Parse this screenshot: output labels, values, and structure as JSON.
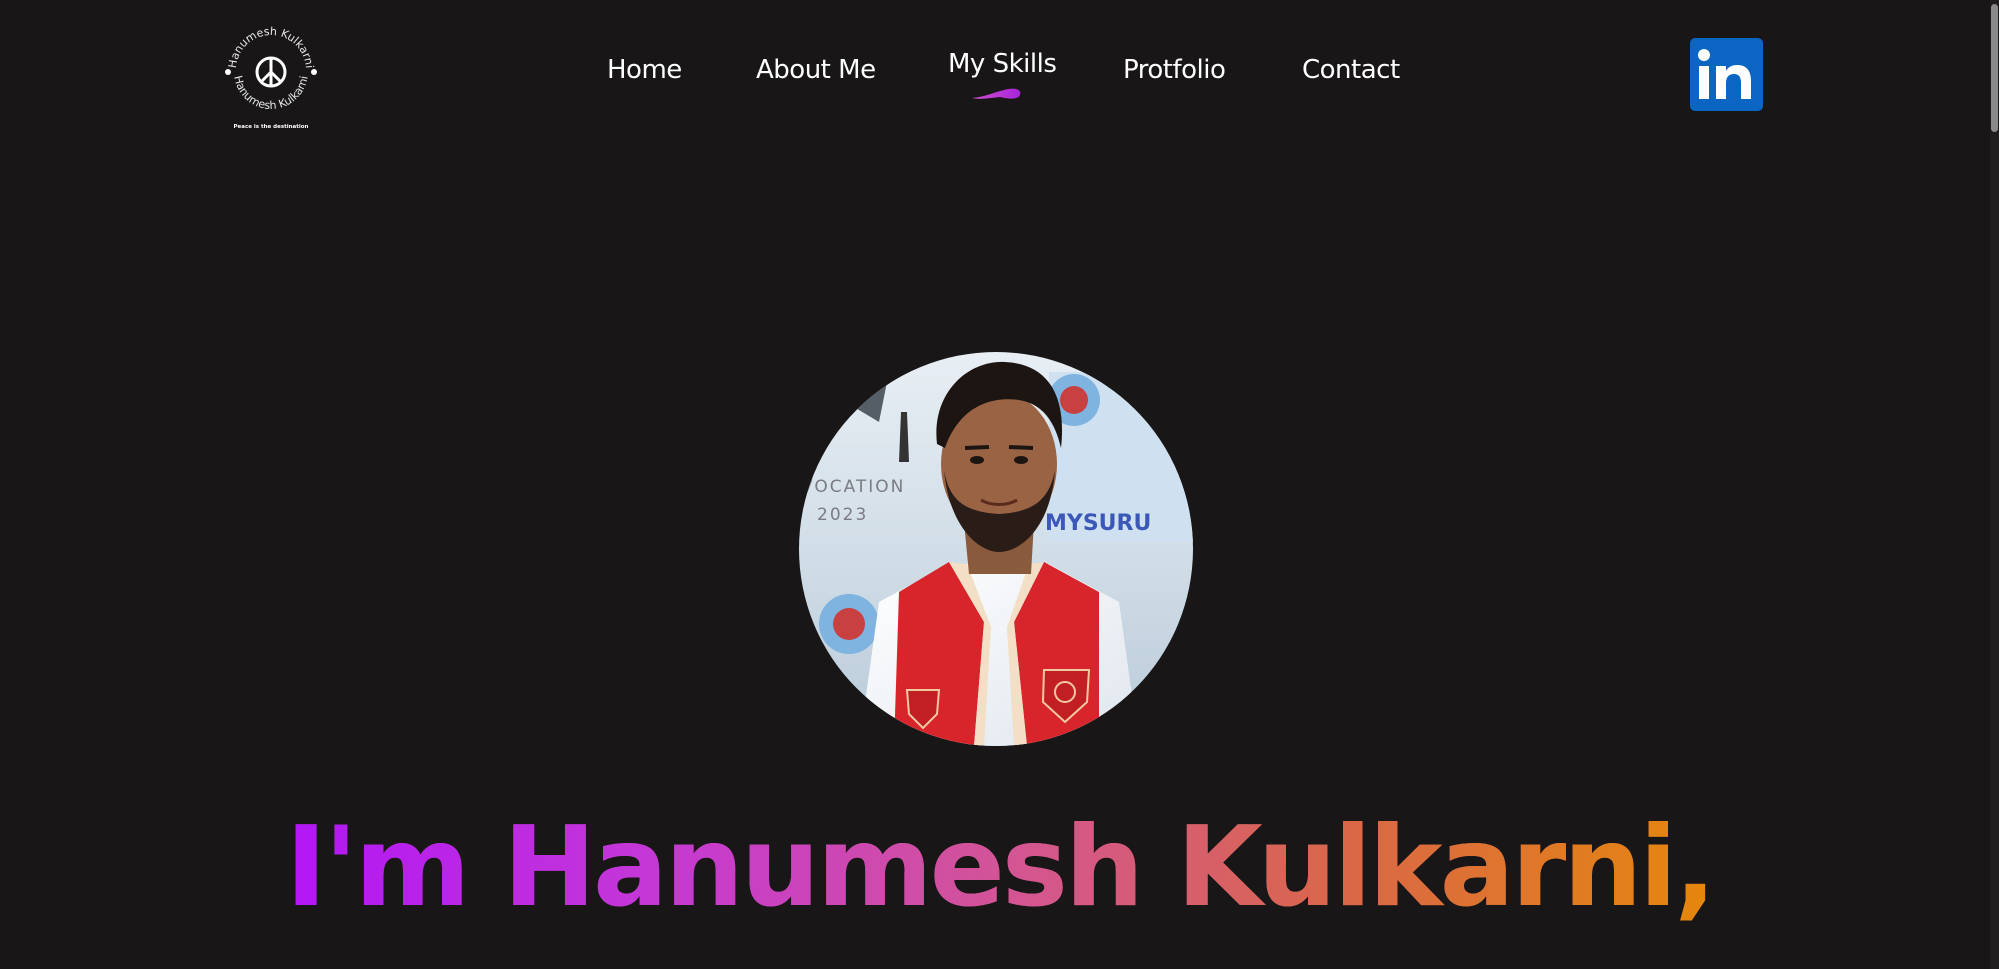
{
  "logo": {
    "name_top": "Hanumesh Kulkarni",
    "name_bottom": "Hanumesh Kulkarni",
    "tagline": "Peace is the destination",
    "icon": "peace-sign-icon"
  },
  "nav": {
    "items": [
      {
        "label": "Home",
        "active": false
      },
      {
        "label": "About Me",
        "active": false
      },
      {
        "label": "My Skills",
        "active": true
      },
      {
        "label": "Protfolio",
        "active": false
      },
      {
        "label": "Contact",
        "active": false
      }
    ]
  },
  "social": {
    "linkedin_label": "in",
    "icon": "linkedin-icon"
  },
  "hero": {
    "title": "I'm Hanumesh Kulkarni,",
    "avatar_icon": "profile-photo",
    "photo_text_left": "VOCATION",
    "photo_text_year": "2023",
    "photo_text_right": "MYSURU"
  },
  "colors": {
    "background": "#181616",
    "text": "#ffffff",
    "accent_purple": "#b216f5",
    "accent_orange": "#e5870c",
    "linkedin_blue": "#0a66c2",
    "active_marker": "#c02fd8"
  }
}
